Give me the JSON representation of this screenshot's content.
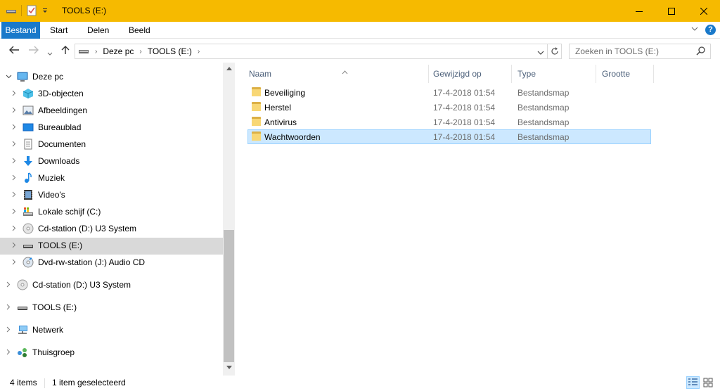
{
  "window": {
    "title": "TOOLS (E:)"
  },
  "ribbon": {
    "tabs": [
      "Bestand",
      "Start",
      "Delen",
      "Beeld"
    ]
  },
  "nav": {
    "breadcrumb": [
      "Deze pc",
      "TOOLS (E:)"
    ],
    "search_placeholder": "Zoeken in TOOLS (E:)"
  },
  "tree": [
    {
      "label": "Deze pc",
      "icon": "computer-icon",
      "expanded": true
    },
    {
      "label": "3D-objecten",
      "icon": "3d-objects-icon"
    },
    {
      "label": "Afbeeldingen",
      "icon": "pictures-icon"
    },
    {
      "label": "Bureaublad",
      "icon": "desktop-icon"
    },
    {
      "label": "Documenten",
      "icon": "documents-icon"
    },
    {
      "label": "Downloads",
      "icon": "downloads-icon"
    },
    {
      "label": "Muziek",
      "icon": "music-icon"
    },
    {
      "label": "Video's",
      "icon": "videos-icon"
    },
    {
      "label": "Lokale schijf (C:)",
      "icon": "local-disk-icon"
    },
    {
      "label": "Cd-station (D:) U3 System",
      "icon": "cd-drive-icon"
    },
    {
      "label": "TOOLS (E:)",
      "icon": "usb-drive-icon",
      "selected": true
    },
    {
      "label": "Dvd-rw-station (J:) Audio CD",
      "icon": "dvd-drive-icon"
    },
    {
      "label": "Cd-station (D:) U3 System",
      "icon": "cd-drive-icon"
    },
    {
      "label": "TOOLS (E:)",
      "icon": "usb-drive-icon"
    },
    {
      "label": "Netwerk",
      "icon": "network-icon"
    },
    {
      "label": "Thuisgroep",
      "icon": "homegroup-icon"
    }
  ],
  "columns": [
    "Naam",
    "Gewijzigd op",
    "Type",
    "Grootte"
  ],
  "files": [
    {
      "name": "Beveiliging",
      "date": "17-4-2018 01:54",
      "type": "Bestandsmap",
      "size": ""
    },
    {
      "name": "Herstel",
      "date": "17-4-2018 01:54",
      "type": "Bestandsmap",
      "size": ""
    },
    {
      "name": "Antivirus",
      "date": "17-4-2018 01:54",
      "type": "Bestandsmap",
      "size": ""
    },
    {
      "name": "Wachtwoorden",
      "date": "17-4-2018 01:54",
      "type": "Bestandsmap",
      "size": "",
      "selected": true
    }
  ],
  "status": {
    "count": "4 items",
    "selection": "1 item geselecteerd"
  },
  "colors": {
    "titlebar": "#f6ba00",
    "accent": "#1979ca",
    "selection": "#cce8ff"
  }
}
